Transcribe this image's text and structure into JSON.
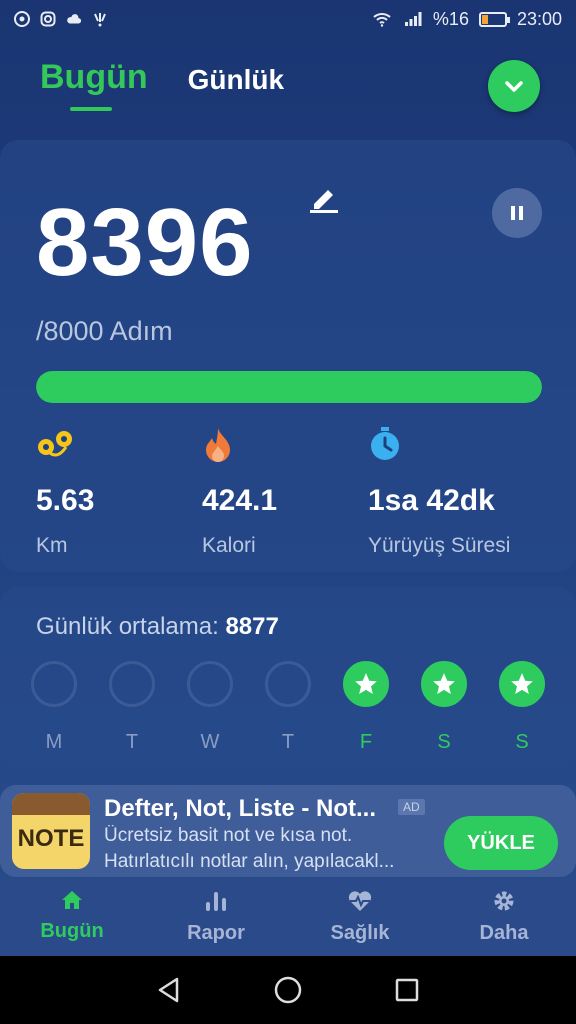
{
  "status_bar": {
    "battery_percent": "%16",
    "time": "23:00",
    "left_icons": [
      "chrome-icon",
      "instagram-icon",
      "cloud-icon",
      "notification-icon"
    ],
    "right_icons": [
      "wifi-icon",
      "signal-icon",
      "battery-icon"
    ]
  },
  "tabs": [
    {
      "label": "Bugün",
      "active": true
    },
    {
      "label": "Günlük",
      "active": false
    }
  ],
  "steps": {
    "count": "8396",
    "goal_label": "/8000 Adım",
    "progress_fraction": 1.0
  },
  "stats": [
    {
      "icon": "distance-icon",
      "value": "5.63",
      "label": "Km"
    },
    {
      "icon": "fire-icon",
      "value": "424.1",
      "label": "Kalori"
    },
    {
      "icon": "stopwatch-icon",
      "value": "1sa 42dk",
      "label": "Yürüyüş Süresi"
    }
  ],
  "weekly": {
    "avg_label": "Günlük ortalama:",
    "avg_value": "8877",
    "days": [
      {
        "label": "M",
        "done": false
      },
      {
        "label": "T",
        "done": false
      },
      {
        "label": "W",
        "done": false
      },
      {
        "label": "T",
        "done": false
      },
      {
        "label": "F",
        "done": true
      },
      {
        "label": "S",
        "done": true
      },
      {
        "label": "S",
        "done": true
      }
    ]
  },
  "ad": {
    "logo_text": "NOTE",
    "title": "Defter, Not, Liste - Not...",
    "badge": "AD",
    "line1": "Ücretsiz basit not ve kısa not.",
    "line2": "Hatırlatıcılı notlar alın, yapılacakl...",
    "button": "YÜKLE"
  },
  "bottom_nav": [
    {
      "label": "Bugün",
      "icon": "home-icon",
      "active": true
    },
    {
      "label": "Rapor",
      "icon": "bar-chart-icon",
      "active": false
    },
    {
      "label": "Sağlık",
      "icon": "heart-icon",
      "active": false
    },
    {
      "label": "Daha",
      "icon": "gear-icon",
      "active": false
    }
  ],
  "colors": {
    "accent": "#2ecc5f",
    "background": "#1f3f7e",
    "fire": "#f07a3a",
    "stopwatch": "#3ab0f0",
    "distance": "#f5c518"
  }
}
